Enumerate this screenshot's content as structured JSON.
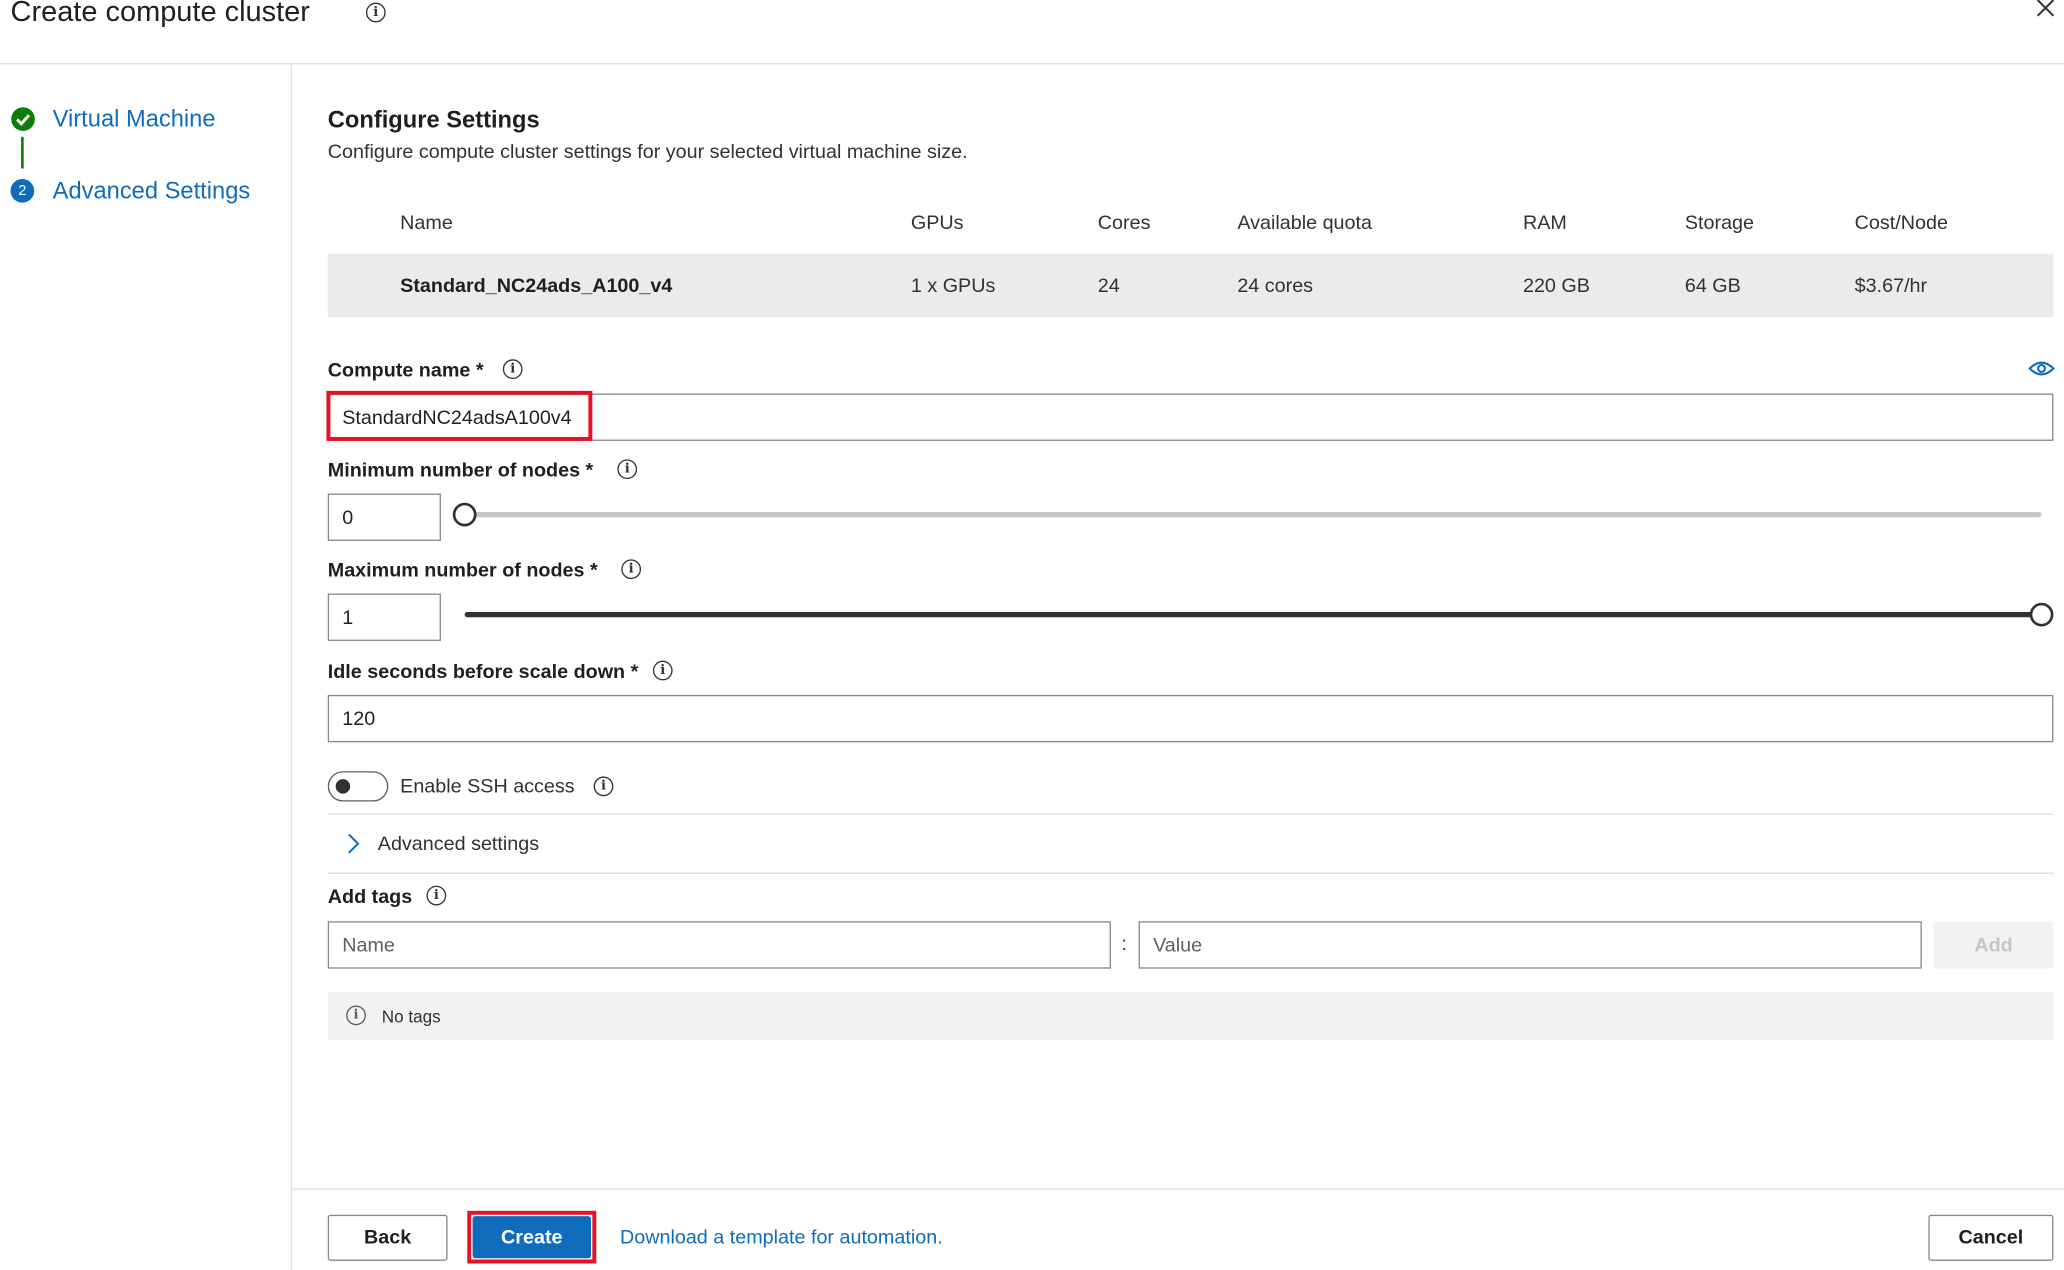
{
  "dialog": {
    "title": "Create compute cluster"
  },
  "steps": [
    {
      "label": "Virtual Machine",
      "number": "",
      "status": "complete"
    },
    {
      "label": "Advanced Settings",
      "number": "2",
      "status": "current"
    }
  ],
  "section": {
    "title": "Configure Settings",
    "description": "Configure compute cluster settings for your selected virtual machine size."
  },
  "vm_table": {
    "headers": [
      "Name",
      "GPUs",
      "Cores",
      "Available quota",
      "RAM",
      "Storage",
      "Cost/Node"
    ],
    "row": [
      "Standard_NC24ads_A100_v4",
      "1 x GPUs",
      "24",
      "24 cores",
      "220 GB",
      "64 GB",
      "$3.67/hr"
    ]
  },
  "form": {
    "compute_name": {
      "label": "Compute name *",
      "value": "StandardNC24adsA100v4"
    },
    "min_nodes": {
      "label": "Minimum number of nodes *",
      "value": "0",
      "slider_fraction": 0
    },
    "max_nodes": {
      "label": "Maximum number of nodes *",
      "value": "1",
      "slider_fraction": 1
    },
    "idle_seconds": {
      "label": "Idle seconds before scale down *",
      "value": "120"
    },
    "ssh": {
      "label": "Enable SSH access",
      "enabled": false
    },
    "advanced": {
      "label": "Advanced settings"
    },
    "tags": {
      "label": "Add tags",
      "name_placeholder": "Name",
      "separator": ":",
      "value_placeholder": "Value",
      "add_label": "Add",
      "empty_message": "No tags"
    }
  },
  "footer": {
    "back_label": "Back",
    "create_label": "Create",
    "template_link": "Download a template for automation.",
    "cancel_label": "Cancel"
  },
  "colors": {
    "accent": "#0f6cbd",
    "success": "#107c10",
    "highlight_box": "#e81123"
  }
}
